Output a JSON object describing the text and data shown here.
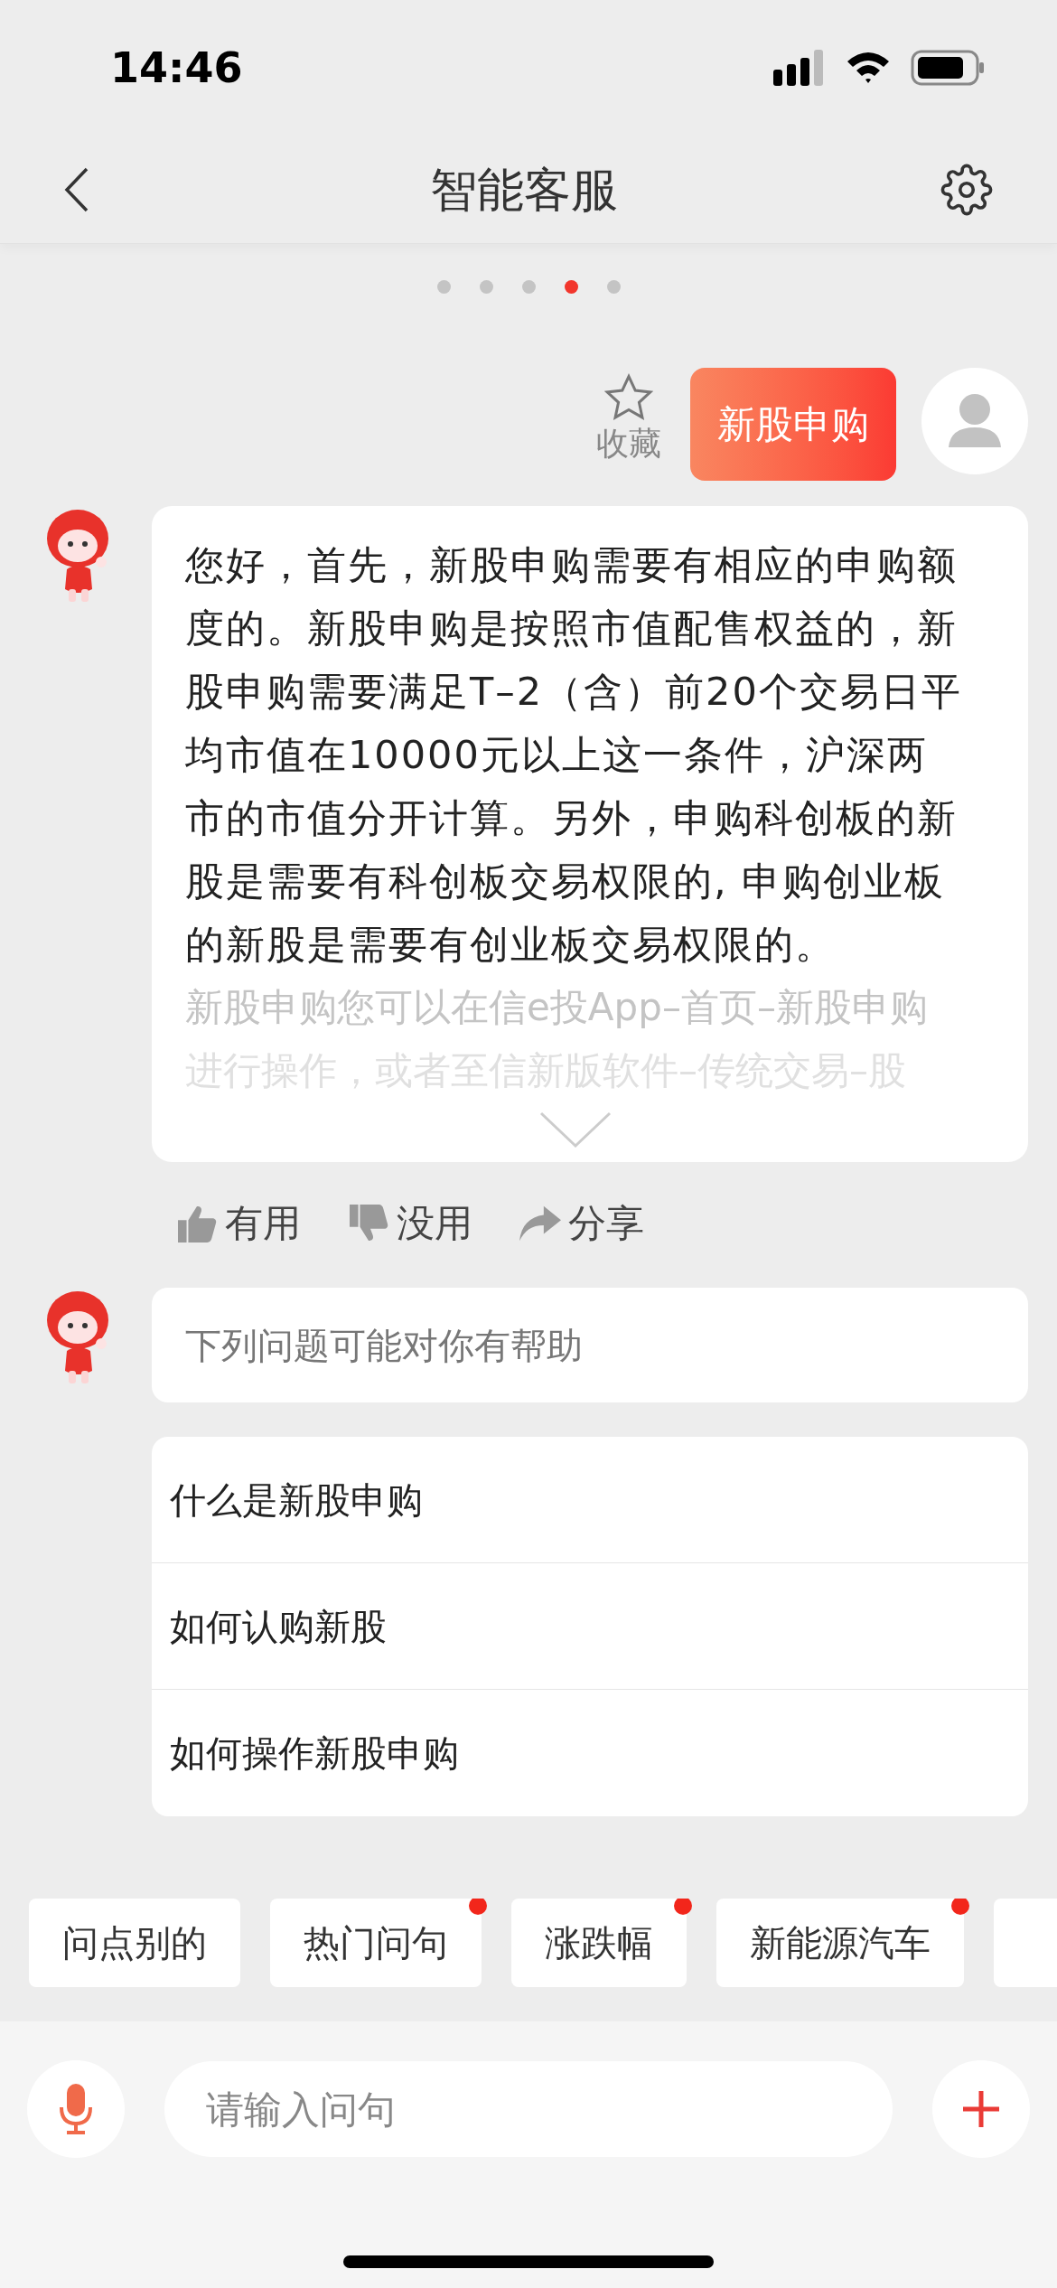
{
  "status_bar": {
    "time": "14:46"
  },
  "header": {
    "title": "智能客服"
  },
  "pager": [
    {
      "selected": false
    },
    {
      "selected": false
    },
    {
      "selected": false
    },
    {
      "selected": true
    },
    {
      "selected": false
    }
  ],
  "user_message": {
    "text": "新股申购",
    "favorite_label": "收藏",
    "favorited": false
  },
  "bot_answer": {
    "paragraphs": [
      "您好，首先，新股申购需要有相应的申购额度的。新股申购是按照市值配售权益的，新股申购需要满足T–2（含）前20个交易日平均市值在10000元以上这一条件，沪深两市的市值分开计算。另外，申购科创板的新股是需要有科创板交易权限的, 申购创业板的新股是需要有创业板交易权限的。"
    ],
    "faded_lines": [
      "新股申购您可以在信e投App–首页–新股申购",
      "进行操作，或者至信新版软件–传统交易–股"
    ],
    "expanded": false
  },
  "feedback": [
    {
      "kind": "like",
      "label": "有用"
    },
    {
      "kind": "dislike",
      "label": "没用"
    },
    {
      "kind": "share",
      "label": "分享"
    }
  ],
  "suggestion_intro": "下列问题可能对你有帮助",
  "suggestions": [
    "什么是新股申购",
    "如何认购新股",
    "如何操作新股申购"
  ],
  "quick_chips": [
    {
      "label": "问点别的",
      "dot": false
    },
    {
      "label": "热门问句",
      "dot": true
    },
    {
      "label": "涨跌幅",
      "dot": true
    },
    {
      "label": "新能源汽车",
      "dot": true
    }
  ],
  "input": {
    "placeholder": "请输入问句"
  }
}
